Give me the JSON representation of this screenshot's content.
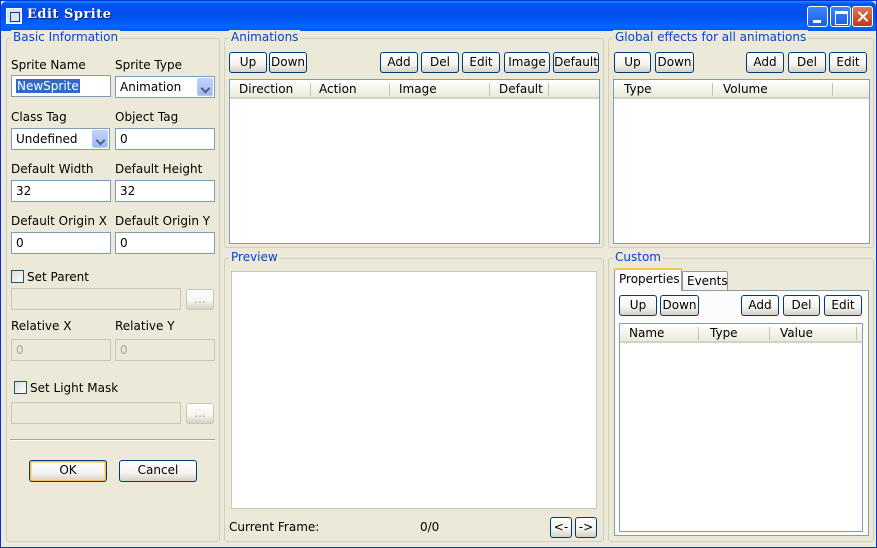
{
  "window": {
    "title": "Edit Sprite"
  },
  "basic_info": {
    "title": "Basic Information",
    "sprite_name_label": "Sprite Name",
    "sprite_name_value": "NewSprite",
    "sprite_type_label": "Sprite Type",
    "sprite_type_value": "Animation",
    "class_tag_label": "Class Tag",
    "class_tag_value": "Undefined",
    "object_tag_label": "Object Tag",
    "object_tag_value": "0",
    "default_width_label": "Default Width",
    "default_width_value": "32",
    "default_height_label": "Default Height",
    "default_height_value": "32",
    "default_origin_x_label": "Default Origin X",
    "default_origin_x_value": "0",
    "default_origin_y_label": "Default Origin Y",
    "default_origin_y_value": "0",
    "set_parent_label": "Set Parent",
    "browse_label": "...",
    "relative_x_label": "Relative X",
    "relative_x_value": "0",
    "relative_y_label": "Relative Y",
    "relative_y_value": "0",
    "set_light_mask_label": "Set Light Mask",
    "ok_label": "OK",
    "cancel_label": "Cancel"
  },
  "animations": {
    "title": "Animations",
    "up_label": "Up",
    "down_label": "Down",
    "add_label": "Add",
    "del_label": "Del",
    "edit_label": "Edit",
    "image_label": "Image",
    "default_label": "Default",
    "columns": [
      "Direction",
      "Action",
      "Image",
      "Default"
    ]
  },
  "global_effects": {
    "title": "Global effects for all animations",
    "up_label": "Up",
    "down_label": "Down",
    "add_label": "Add",
    "del_label": "Del",
    "edit_label": "Edit",
    "columns": [
      "Type",
      "Volume"
    ]
  },
  "preview": {
    "title": "Preview",
    "current_frame_label": "Current Frame:",
    "frame_value": "0/0",
    "prev_label": "<-",
    "next_label": "->"
  },
  "custom": {
    "title": "Custom",
    "tabs": [
      "Properties",
      "Events"
    ],
    "up_label": "Up",
    "down_label": "Down",
    "add_label": "Add",
    "del_label": "Del",
    "edit_label": "Edit",
    "columns": [
      "Name",
      "Type",
      "Value"
    ]
  }
}
